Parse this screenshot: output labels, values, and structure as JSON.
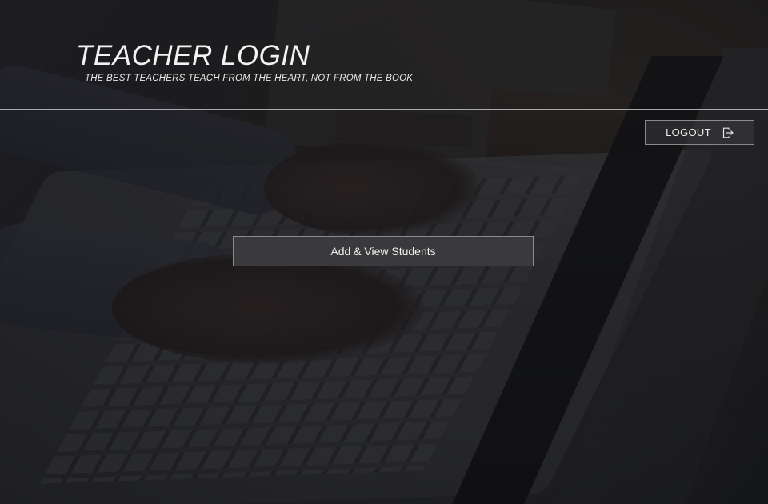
{
  "header": {
    "title": "TEACHER LOGIN",
    "subtitle": "THE BEST TEACHERS TEACH FROM THE HEART, NOT FROM THE BOOK"
  },
  "toolbar": {
    "logout_label": "LOGOUT",
    "logout_icon": "logout-icon"
  },
  "main": {
    "action_label": "Add & View Students"
  },
  "colors": {
    "text": "#f2f2f2",
    "divider": "#a9a9ab",
    "button_bg": "#3a3a3d",
    "button_border": "#8a8a8c"
  }
}
